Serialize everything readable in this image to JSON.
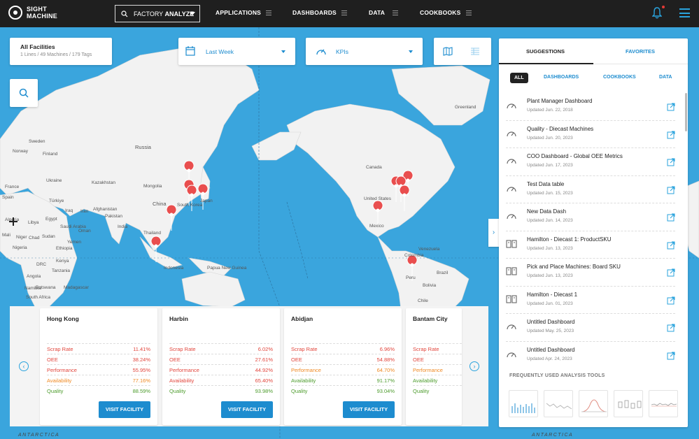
{
  "brand": {
    "name_line1": "SIGHT",
    "name_line2": "MACHINE"
  },
  "nav": {
    "factory_analyze": {
      "prefix": "FACTORY ",
      "bold": "ANALYZE"
    },
    "items": [
      "APPLICATIONS",
      "DASHBOARDS",
      "DATA",
      "COOKBOOKS"
    ]
  },
  "facilities_panel": {
    "title": "All Facilities",
    "subtitle": "1 Lines / 49 Machines / 179 Tags"
  },
  "date_filter": {
    "label": "Last Week"
  },
  "kpi_filter": {
    "label": "KPIs"
  },
  "map_labels": [
    "Greenland",
    "Russia",
    "Canada",
    "United States",
    "Mexico",
    "Colombia",
    "Venezuela",
    "Peru",
    "Brazil",
    "Bolivia",
    "Chile",
    "Mongolia",
    "Kazakhstan",
    "China",
    "India",
    "Afghanistan",
    "Iran",
    "Iraq",
    "Saudi Arabia",
    "Türkiye",
    "Egypt",
    "Libya",
    "Algeria",
    "Mali",
    "Niger",
    "Nigeria",
    "Chad",
    "Sudan",
    "Ethiopia",
    "DRC",
    "Kenya",
    "Tanzania",
    "Angola",
    "Namibia",
    "Botswana",
    "South Africa",
    "Madagascar",
    "Thailand",
    "Indonesia",
    "Papua New Guinea",
    "Sweden",
    "Norway",
    "Finland",
    "France",
    "Spain",
    "Ukraine",
    "Japan",
    "South Korea",
    "Pakistan",
    "Oman",
    "Yemen"
  ],
  "antarctica": "ANTARCTICA",
  "facility_cards": [
    {
      "name": "Hong Kong",
      "metrics": [
        {
          "label": "Scrap Rate",
          "value": "11.41%",
          "status": "red"
        },
        {
          "label": "OEE",
          "value": "38.24%",
          "status": "red"
        },
        {
          "label": "Performance",
          "value": "55.95%",
          "status": "red"
        },
        {
          "label": "Availability",
          "value": "77.16%",
          "status": "orange"
        },
        {
          "label": "Quality",
          "value": "88.59%",
          "status": "green"
        }
      ],
      "button": "VISIT FACILITY"
    },
    {
      "name": "Harbin",
      "metrics": [
        {
          "label": "Scrap Rate",
          "value": "6.02%",
          "status": "red"
        },
        {
          "label": "OEE",
          "value": "27.61%",
          "status": "red"
        },
        {
          "label": "Performance",
          "value": "44.92%",
          "status": "red"
        },
        {
          "label": "Availability",
          "value": "65.40%",
          "status": "red"
        },
        {
          "label": "Quality",
          "value": "93.98%",
          "status": "green"
        }
      ],
      "button": "VISIT FACILITY"
    },
    {
      "name": "Abidjan",
      "metrics": [
        {
          "label": "Scrap Rate",
          "value": "6.96%",
          "status": "red"
        },
        {
          "label": "OEE",
          "value": "54.88%",
          "status": "red"
        },
        {
          "label": "Performance",
          "value": "64.70%",
          "status": "orange"
        },
        {
          "label": "Availability",
          "value": "91.17%",
          "status": "green"
        },
        {
          "label": "Quality",
          "value": "93.04%",
          "status": "green"
        }
      ],
      "button": "VISIT FACILITY"
    },
    {
      "name": "Bantam City",
      "metrics": [
        {
          "label": "Scrap Rate",
          "status": "red"
        },
        {
          "label": "OEE",
          "status": "red"
        },
        {
          "label": "Performance",
          "status": "orange"
        },
        {
          "label": "Availability",
          "status": "green"
        },
        {
          "label": "Quality",
          "status": "green"
        }
      ]
    }
  ],
  "sidebar": {
    "tabs": [
      "SUGGESTIONS",
      "FAVORITES"
    ],
    "filters": [
      "ALL",
      "DASHBOARDS",
      "COOKBOOKS",
      "DATA"
    ],
    "items": [
      {
        "title": "Plant Manager Dashboard",
        "date": "Updated Jun. 22, 2018",
        "icon": "gauge-icon"
      },
      {
        "title": "Quality - Diecast Machines",
        "date": "Updated Jun. 20, 2023",
        "icon": "gauge-icon"
      },
      {
        "title": "COO Dashboard - Global OEE Metrics",
        "date": "Updated Jun. 17, 2023",
        "icon": "gauge-icon"
      },
      {
        "title": "Test Data table",
        "date": "Updated Jun. 15, 2023",
        "icon": "gauge-icon"
      },
      {
        "title": "New Data Dash",
        "date": "Updated Jun. 14, 2023",
        "icon": "gauge-icon"
      },
      {
        "title": "Hamilton - Diecast 1: ProductSKU",
        "date": "Updated Jun. 13, 2023",
        "icon": "book-icon"
      },
      {
        "title": "Pick and Place Machines: Board SKU",
        "date": "Updated Jun. 13, 2023",
        "icon": "book-icon"
      },
      {
        "title": "Hamilton - Diecast 1",
        "date": "Updated Jun. 01, 2023",
        "icon": "book-icon"
      },
      {
        "title": "Untitled Dashboard",
        "date": "Updated May. 25, 2023",
        "icon": "gauge-icon"
      },
      {
        "title": "Untitled Dashboard",
        "date": "Updated Apr. 24, 2023",
        "icon": "gauge-icon"
      }
    ],
    "tools_title": "FREQUENTLY USED ANALYSIS TOOLS"
  }
}
